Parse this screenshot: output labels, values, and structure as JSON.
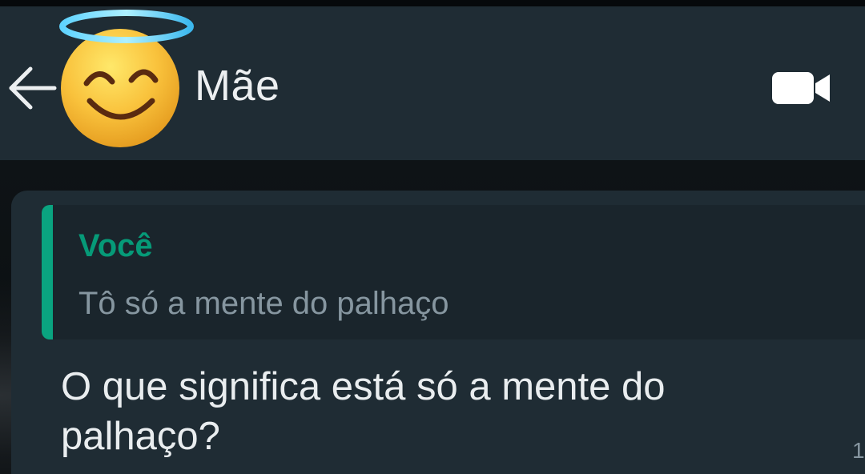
{
  "header": {
    "contact_name": "Mãe",
    "icons": {
      "back": "arrow-left-icon",
      "avatar": "smiling-face-with-halo-emoji",
      "video": "video-camera-icon"
    }
  },
  "message": {
    "quoted": {
      "author": "Você",
      "text": "Tô só a mente do palhaço"
    },
    "text": "O que significa está só a mente do palhaço?",
    "time_partial": "1"
  },
  "colors": {
    "header_bg": "#1f2c34",
    "bubble_bg": "#1f2c34",
    "quote_bg": "#1a252c",
    "accent": "#06cf9c",
    "quote_author": "#069a78",
    "secondary_text": "#8696a0",
    "primary_text": "#e9edef"
  }
}
